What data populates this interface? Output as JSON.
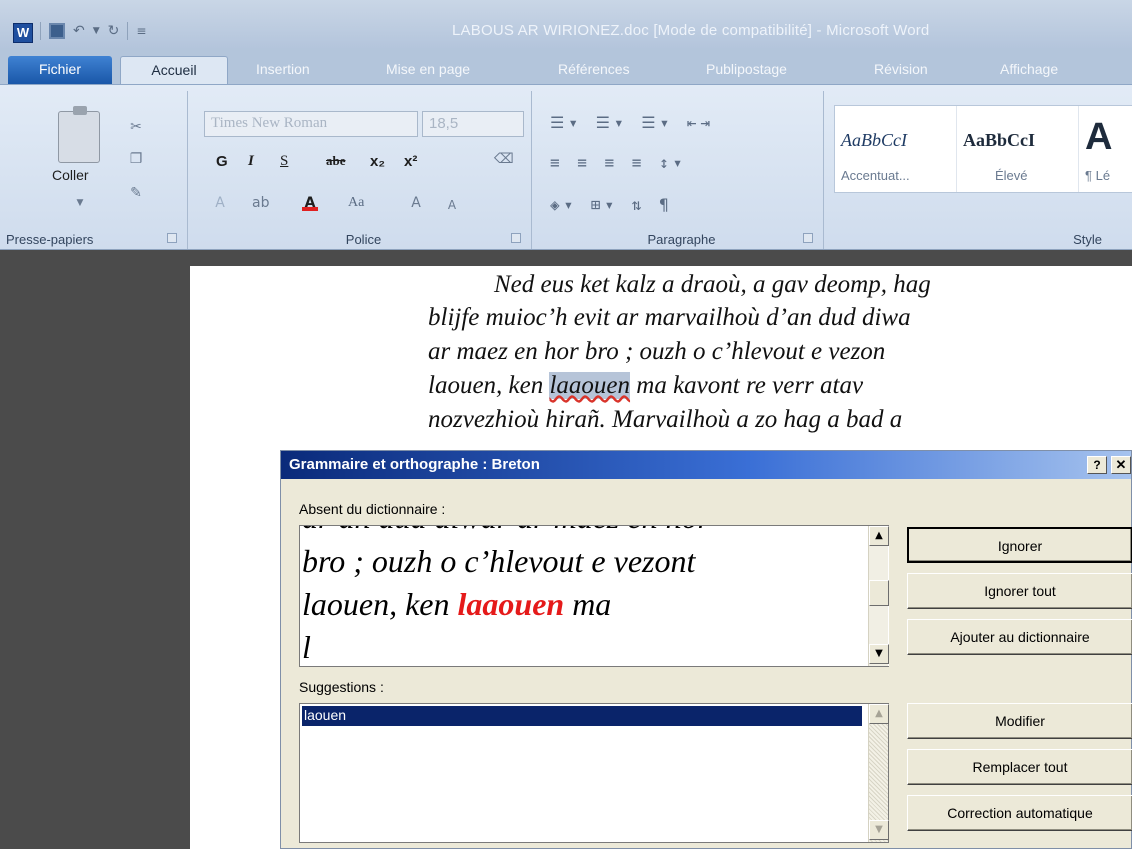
{
  "window": {
    "title": "LABOUS AR WIRIONEZ.doc [Mode de compatibilité]  -  Microsoft Word",
    "app_icon": "W"
  },
  "tabs": [
    {
      "label": "Fichier"
    },
    {
      "label": "Accueil"
    },
    {
      "label": "Insertion"
    },
    {
      "label": "Mise en page"
    },
    {
      "label": "Références"
    },
    {
      "label": "Publipostage"
    },
    {
      "label": "Révision"
    },
    {
      "label": "Affichage"
    }
  ],
  "ribbon": {
    "clipboard": {
      "paste_label": "Coller",
      "group_label": "Presse-papiers"
    },
    "font": {
      "group_label": "Police",
      "font_name": "Times New Roman",
      "font_size": "18,5",
      "bold": "G",
      "italic": "I",
      "underline": "S",
      "strike": "abe",
      "subscript": "x₂",
      "superscript": "x²",
      "change_case": "Aa"
    },
    "paragraph": {
      "group_label": "Paragraphe"
    },
    "style": {
      "group_label": "Style",
      "items": [
        {
          "sample": "AaBbCcI",
          "name": "Accentuat..."
        },
        {
          "sample": "AaBbCcI",
          "name": "Élevé"
        },
        {
          "sample": "A",
          "name": "¶ Lé"
        }
      ]
    }
  },
  "document": {
    "lines": [
      "Ned eus ket kalz a draoù, a gav deomp, hag",
      "blijfe muioc’h evit ar marvailhoù d’an dud diwa",
      "ar maez en hor bro ; ouzh o c’hlevout e vezon",
      "laouen, ken ",
      "nozvezhioù hirañ. Marvailhoù a zo hag a bad a"
    ],
    "highlighted_word": "laaouen",
    "line4_rest": " ma kavont re verr atav"
  },
  "dialog": {
    "title": "Grammaire et orthographe : Breton",
    "help_label": "?",
    "close_label": "✕",
    "absent_label": "Absent du dictionnaire :",
    "context_lines": [
      "ar an dud diwar ar maez en hor",
      "bro ; ouzh o c’hlevout e vezont",
      "laouen, ken ",
      "l"
    ],
    "error_word": "laaouen",
    "context_line3_rest": " ma",
    "suggestions_label": "Suggestions :",
    "suggestions": [
      "laouen"
    ],
    "buttons": {
      "ignore": "Ignorer",
      "ignore_all": "Ignorer tout",
      "add_dictionary": "Ajouter au dictionnaire",
      "change": "Modifier",
      "replace_all": "Remplacer tout",
      "autocorrect": "Correction automatique"
    }
  }
}
